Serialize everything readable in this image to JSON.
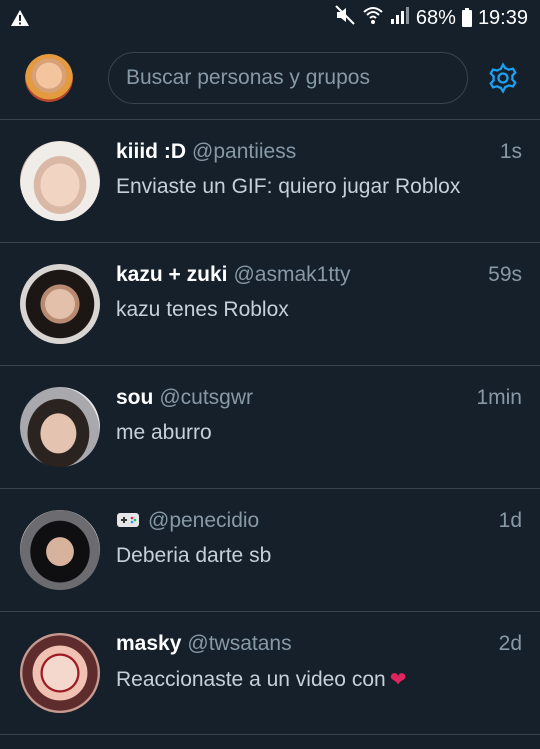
{
  "statusbar": {
    "battery_percent": "68%",
    "time": "19:39",
    "icons": [
      "warning-icon",
      "mute-icon",
      "wifi-icon",
      "signal-icon",
      "battery-icon"
    ]
  },
  "header": {
    "search_placeholder": "Buscar personas y grupos",
    "settings_icon": "gear-icon"
  },
  "colors": {
    "background": "#15202b",
    "divider": "#38444d",
    "secondary_text": "#8899a6",
    "accent": "#1da1f2",
    "heart": "#e0245e"
  },
  "conversations": [
    {
      "name": "kiiid :D",
      "handle": "@pantiiess",
      "time": "1s",
      "message": "Enviaste un GIF: quiero jugar Roblox"
    },
    {
      "name": "kazu + zuki",
      "handle": "@asmak1tty",
      "time": "59s",
      "message": "kazu tenes Roblox"
    },
    {
      "name": "sou",
      "handle": "@cutsgwr",
      "time": "1min",
      "message": "me aburro"
    },
    {
      "name": "",
      "handle": "@penecidio",
      "time": "1d",
      "message": "Deberia darte sb",
      "name_icon": "gamepad-icon"
    },
    {
      "name": "masky",
      "handle": "@twsatans",
      "time": "2d",
      "message": "Reaccionaste a un video con",
      "message_icon": "heart-icon"
    }
  ]
}
